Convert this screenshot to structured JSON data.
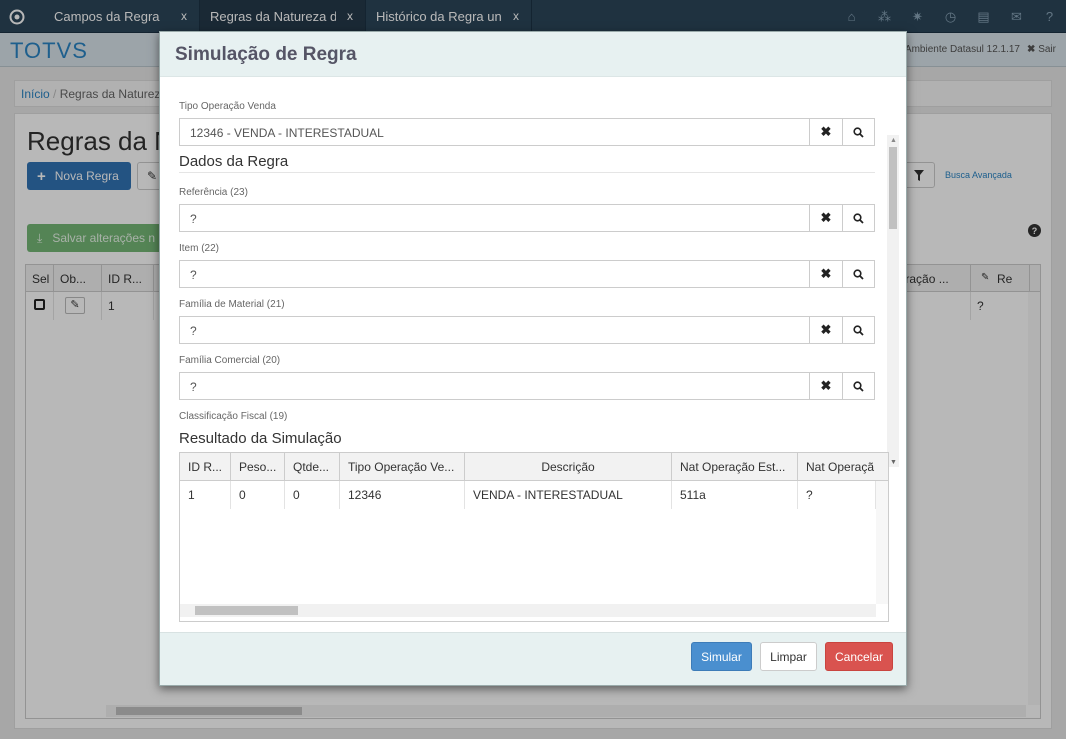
{
  "topbar": {
    "tabs": [
      {
        "label": "Campos da Regra",
        "close": "x"
      },
      {
        "label": "Regras da Natureza d",
        "close": "x"
      },
      {
        "label": "Histórico da Regra unc",
        "close": "x"
      }
    ]
  },
  "brand": {
    "name": "TOTVS",
    "environment": "Ambiente Datasul 12.1.17",
    "exit": "Sair"
  },
  "breadcrumb": {
    "home": "Início",
    "current": "Regras da Natureza"
  },
  "page": {
    "title": "Regras da N",
    "new_rule": "Nova Regra",
    "save_changes": "Salvar alterações n",
    "advanced_search": "Busca Avançada"
  },
  "main_grid": {
    "headers": [
      "Sel",
      "Ob...",
      "ID R...",
      "peração ...",
      "Re"
    ],
    "row": {
      "id": "1",
      "last": "?"
    }
  },
  "modal": {
    "title": "Simulação de Regra",
    "tipo_operacao": {
      "label": "Tipo Operação Venda",
      "value": "12346 - VENDA - INTERESTADUAL"
    },
    "dados_title": "Dados da Regra",
    "fields": [
      {
        "label": "Referência (23)",
        "value": "?"
      },
      {
        "label": "Item (22)",
        "value": "?"
      },
      {
        "label": "Família de Material (21)",
        "value": "?"
      },
      {
        "label": "Família Comercial (20)",
        "value": "?"
      }
    ],
    "next_label": "Classificação Fiscal (19)",
    "result_title": "Resultado da Simulação",
    "result_headers": [
      "ID R...",
      "Peso...",
      "Qtde...",
      "Tipo Operação Ve...",
      "Descrição",
      "Nat Operação Est...",
      "Nat Operaçã"
    ],
    "result_row": [
      "1",
      "0",
      "0",
      "12346",
      "VENDA - INTERESTADUAL",
      "511a",
      "?"
    ],
    "buttons": {
      "simulate": "Simular",
      "clear": "Limpar",
      "cancel": "Cancelar"
    }
  }
}
